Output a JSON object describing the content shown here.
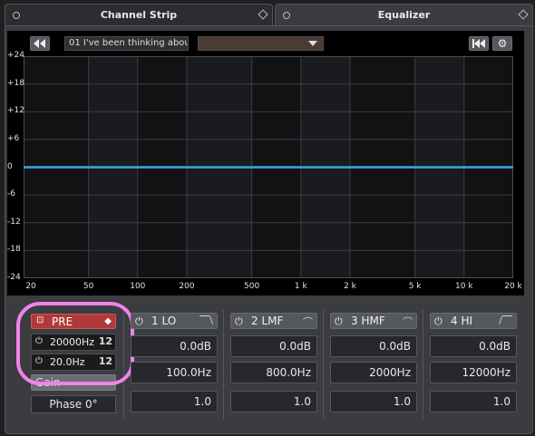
{
  "tabs": [
    {
      "label": "Channel Strip",
      "active": false
    },
    {
      "label": "Equalizer",
      "active": true
    }
  ],
  "toolbar": {
    "back_icon": "back-arrows-icon",
    "preset_name": "01 I've been thinking abou",
    "dropdown_value": "",
    "reset_icon": "skip-back-icon",
    "settings_icon": "gear-icon"
  },
  "graph": {
    "y_ticks": [
      "+24",
      "+18",
      "+12",
      "+6",
      "0",
      "-6",
      "-12",
      "-18",
      "-24"
    ],
    "x_ticks": [
      "20",
      "50",
      "100",
      "200",
      "500",
      "1 k",
      "2 k",
      "5 k",
      "10 k",
      "20 k"
    ],
    "curve_color": "#3aa6e8",
    "curve_db": 0
  },
  "pre": {
    "label": "PRE",
    "highpass": "20000Hz",
    "lowpass": "20.0Hz",
    "slope_hp": "12",
    "slope_lp": "12",
    "gain_label": "Gain",
    "phase_label": "Phase 0°"
  },
  "bands": [
    {
      "name": "1 LO",
      "gain": "0.0dB",
      "freq": "100.0Hz",
      "q": "1.0",
      "type_icon": "low-shelf-icon"
    },
    {
      "name": "2 LMF",
      "gain": "0.0dB",
      "freq": "800.0Hz",
      "q": "1.0",
      "type_icon": "peak-icon"
    },
    {
      "name": "3 HMF",
      "gain": "0.0dB",
      "freq": "2000Hz",
      "q": "1.0",
      "type_icon": "peak-icon"
    },
    {
      "name": "4 HI",
      "gain": "0.0dB",
      "freq": "12000Hz",
      "q": "1.0",
      "type_icon": "high-shelf-icon"
    }
  ],
  "colors": {
    "pre_active": "#b03a3a",
    "highlight": "#f083e8"
  }
}
